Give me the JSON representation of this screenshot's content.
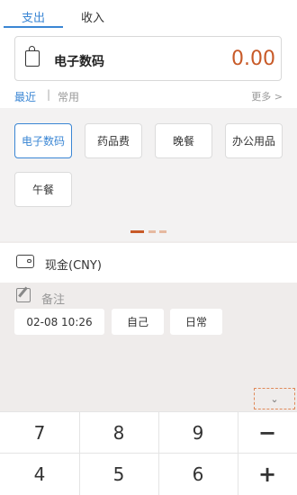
{
  "tabs": [
    {
      "label": "支出",
      "active": true
    },
    {
      "label": "收入",
      "active": false
    }
  ],
  "category": {
    "name": "电子数码",
    "icon": "shopping-bag-icon"
  },
  "amount": "0.00",
  "subtabs": {
    "recent": "最近",
    "divider": "|",
    "common": "常用",
    "more": "更多 >"
  },
  "categories": [
    "电子数码",
    "药品费",
    "晚餐",
    "办公用品",
    "午餐"
  ],
  "selected_category": "电子数码",
  "account": {
    "label": "现金(CNY)",
    "icon": "wallet-icon"
  },
  "note": {
    "placeholder": "备注",
    "icon": "edit-icon"
  },
  "meta": {
    "datetime": "02-08 10:26",
    "member": "自己",
    "tag": "日常"
  },
  "collapse_icon": "chevron-down-icon",
  "keys": {
    "k7": "7",
    "k8": "8",
    "k9": "9",
    "minus": "−",
    "k4": "4",
    "k5": "5",
    "k6": "6",
    "plus": "+"
  },
  "colors": {
    "accent": "#3a86d4",
    "amount": "#c85a28"
  }
}
